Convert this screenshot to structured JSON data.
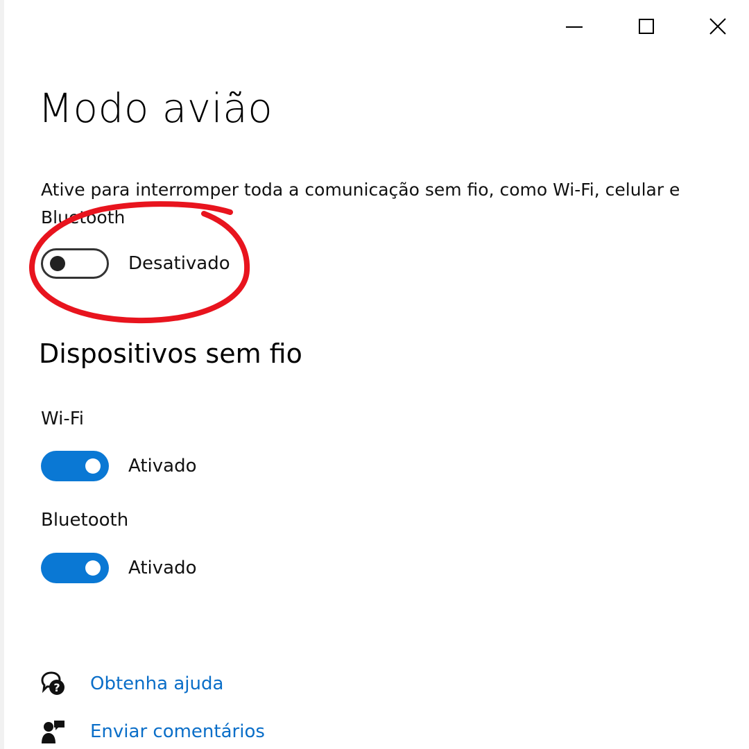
{
  "window_controls": {
    "minimize_icon": "minimize-icon",
    "maximize_icon": "maximize-icon",
    "close_icon": "close-icon"
  },
  "page": {
    "title": "Modo avião",
    "description": "Ative para interromper toda a comunicação sem fio, como Wi-Fi, celular e Bluetooth"
  },
  "airplane_mode": {
    "state": "Desativado",
    "on": false
  },
  "wireless": {
    "section_title": "Dispositivos sem fio",
    "wifi": {
      "label": "Wi-Fi",
      "state": "Ativado",
      "on": true
    },
    "bluetooth": {
      "label": "Bluetooth",
      "state": "Ativado",
      "on": true
    }
  },
  "links": {
    "help": {
      "label": "Obtenha ajuda",
      "icon": "help-chat-icon"
    },
    "feedback": {
      "label": "Enviar comentários",
      "icon": "feedback-icon"
    }
  },
  "colors": {
    "accent": "#0a78d4",
    "link": "#0a6ec8",
    "annotation": "#e8141e"
  }
}
